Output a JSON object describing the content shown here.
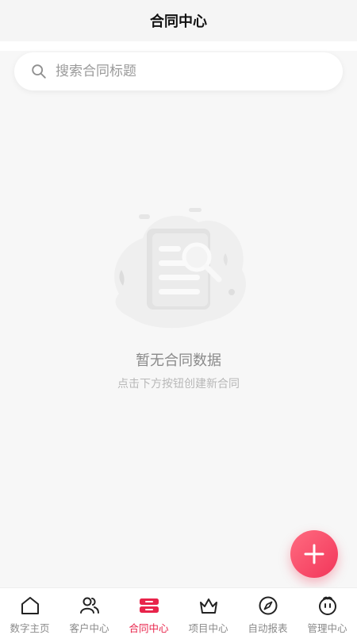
{
  "header": {
    "title": "合同中心"
  },
  "search": {
    "placeholder": "搜索合同标题",
    "value": ""
  },
  "empty_state": {
    "title": "暂无合同数据",
    "subtitle": "点击下方按钮创建新合同",
    "illustration": "empty-document-search-icon"
  },
  "fab": {
    "icon": "plus-icon"
  },
  "colors": {
    "accent": "#e8234a",
    "fab_gradient_start": "#ff6b80",
    "fab_gradient_end": "#f2365a",
    "inactive": "#8a8a8a",
    "background": "#f7f7f7"
  },
  "tabbar": {
    "items": [
      {
        "label": "数字主页",
        "icon": "home-icon",
        "active": false
      },
      {
        "label": "客户中心",
        "icon": "users-icon",
        "active": false
      },
      {
        "label": "合同中心",
        "icon": "contract-icon",
        "active": true
      },
      {
        "label": "项目中心",
        "icon": "crown-icon",
        "active": false
      },
      {
        "label": "自动报表",
        "icon": "compass-icon",
        "active": false
      },
      {
        "label": "管理中心",
        "icon": "face-icon",
        "active": false
      }
    ]
  }
}
